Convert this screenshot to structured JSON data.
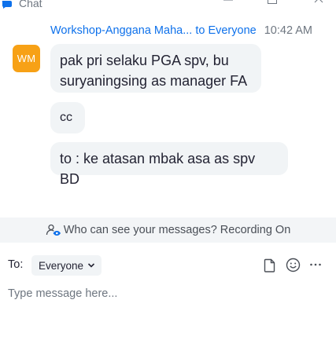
{
  "window": {
    "title": "Chat",
    "accent": "#0e71eb"
  },
  "message_group": {
    "sender": "Workshop-Anggana Maha...",
    "to_word": "to",
    "recipient": "Everyone",
    "time": "10:42 AM",
    "avatar_initials": "WM",
    "avatar_color": "#f7a116",
    "messages": [
      "pak pri selaku PGA spv, bu suryaningsing as manager FA",
      "cc",
      "to : ke atasan mbak asa as spv BD"
    ]
  },
  "privacy": {
    "text": "Who can see your messages? Recording On",
    "icon": "people-eye-icon"
  },
  "composer": {
    "to_label": "To:",
    "recipient_value": "Everyone",
    "placeholder": "Type message here...",
    "icons": [
      "file-icon",
      "emoji-icon",
      "more-icon"
    ]
  }
}
